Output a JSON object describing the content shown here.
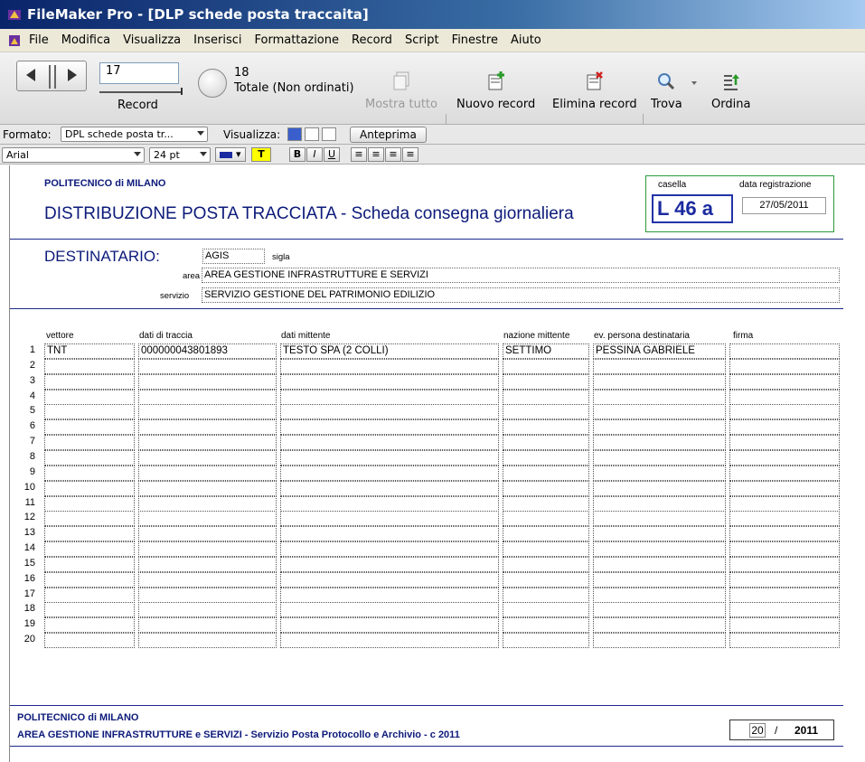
{
  "window": {
    "title": "FileMaker Pro - [DLP schede posta traccaita]"
  },
  "menu": [
    "File",
    "Modifica",
    "Visualizza",
    "Inserisci",
    "Formattazione",
    "Record",
    "Script",
    "Finestre",
    "Aiuto"
  ],
  "toolbar": {
    "record_value": "17",
    "record_label": "Record",
    "total_count": "18",
    "total_label": "Totale (Non ordinati)",
    "show_all": "Mostra tutto",
    "new_record": "Nuovo record",
    "delete_record": "Elimina record",
    "find": "Trova",
    "sort": "Ordina"
  },
  "formatbar": {
    "format_label": "Formato:",
    "format_value": "DPL schede posta tr...",
    "view_label": "Visualizza:",
    "preview": "Anteprima"
  },
  "stylebar": {
    "font": "Arial",
    "size": "24 pt"
  },
  "doc": {
    "org": "POLITECNICO di MILANO",
    "title": "DISTRIBUZIONE POSTA TRACCIATA - Scheda consegna giornaliera",
    "casella_label": "casella",
    "casella_value": "L 46 a",
    "data_label": "data registrazione",
    "data_value": "27/05/2011",
    "dest_label": "DESTINATARIO:",
    "sigla_value": "AGIS",
    "sigla_label": "sigla",
    "area_label": "area",
    "area_value": "AREA GESTIONE INFRASTRUTTURE E SERVIZI",
    "servizio_label": "servizio",
    "servizio_value": "SERVIZIO GESTIONE DEL PATRIMONIO EDILIZIO"
  },
  "table": {
    "headers": [
      "vettore",
      "dati di traccia",
      "dati mittente",
      "nazione mittente",
      "ev. persona destinataria",
      "firma"
    ],
    "rows": [
      [
        "TNT",
        "000000043801893",
        "TESTO SPA (2 COLLI)",
        "SETTIMO",
        "PESSINA GABRIELE",
        ""
      ],
      [
        "",
        "",
        "",
        "",
        "",
        ""
      ],
      [
        "",
        "",
        "",
        "",
        "",
        ""
      ],
      [
        "",
        "",
        "",
        "",
        "",
        ""
      ],
      [
        "",
        "",
        "",
        "",
        "",
        ""
      ],
      [
        "",
        "",
        "",
        "",
        "",
        ""
      ],
      [
        "",
        "",
        "",
        "",
        "",
        ""
      ],
      [
        "",
        "",
        "",
        "",
        "",
        ""
      ],
      [
        "",
        "",
        "",
        "",
        "",
        ""
      ],
      [
        "",
        "",
        "",
        "",
        "",
        ""
      ],
      [
        "",
        "",
        "",
        "",
        "",
        ""
      ],
      [
        "",
        "",
        "",
        "",
        "",
        ""
      ],
      [
        "",
        "",
        "",
        "",
        "",
        ""
      ],
      [
        "",
        "",
        "",
        "",
        "",
        ""
      ],
      [
        "",
        "",
        "",
        "",
        "",
        ""
      ],
      [
        "",
        "",
        "",
        "",
        "",
        ""
      ],
      [
        "",
        "",
        "",
        "",
        "",
        ""
      ],
      [
        "",
        "",
        "",
        "",
        "",
        ""
      ],
      [
        "",
        "",
        "",
        "",
        "",
        ""
      ],
      [
        "",
        "",
        "",
        "",
        "",
        ""
      ]
    ],
    "row_numbers": [
      "1",
      "2",
      "3",
      "4",
      "5",
      "6",
      "7",
      "8",
      "9",
      "10",
      "11",
      "12",
      "13",
      "14",
      "15",
      "16",
      "17",
      "18",
      "19",
      "20"
    ]
  },
  "footer": {
    "org": "POLITECNICO di MILANO",
    "line": "AREA GESTIONE INFRASTRUTTURE e SERVIZI - Servizio Posta Protocollo e Archivio  -  c 2011",
    "page_num": "20",
    "page_sep": "/",
    "year": "2011"
  }
}
